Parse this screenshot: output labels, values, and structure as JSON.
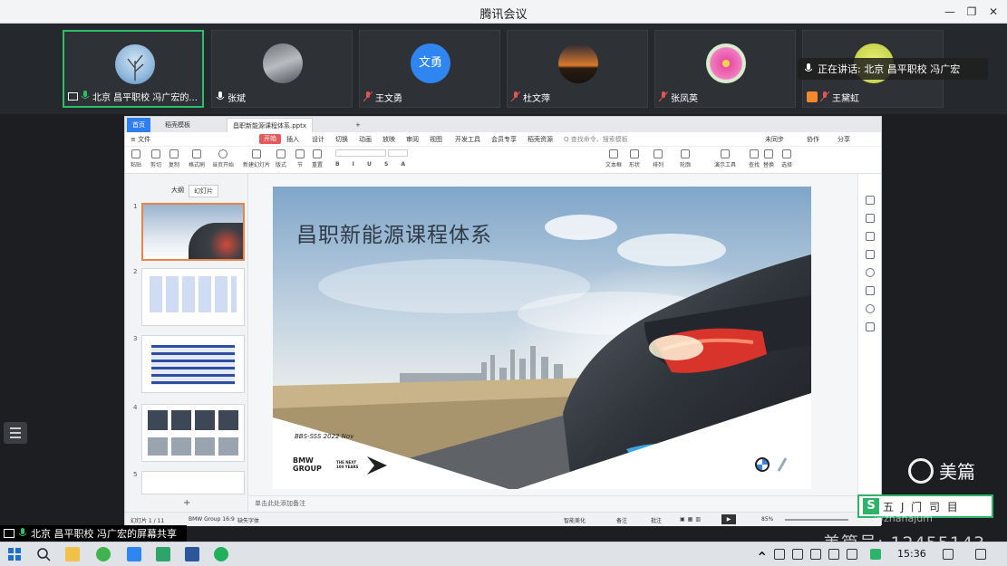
{
  "window": {
    "title": "腾讯会议"
  },
  "participants": [
    {
      "name": "北京 昌平职校 冯广宏的...",
      "avatar": "tree-photo-avatar"
    },
    {
      "name": "张斌",
      "avatar": "photo-avatar"
    },
    {
      "name": "王文勇",
      "avatar_text": "文勇",
      "avatar_color": "#2f86f0"
    },
    {
      "name": "杜文萍",
      "avatar": "sunset-avatar"
    },
    {
      "name": "张凤英",
      "avatar": "flower-avatar"
    },
    {
      "name": "王黛虹",
      "avatar": "yellow-avatar"
    }
  ],
  "speaking": {
    "label": "正在讲话: 北京 昌平职校 冯广宏"
  },
  "wps": {
    "tabs": {
      "home": "首页",
      "template": "稻壳模板",
      "file": "昌职新能源课程体系.pptx",
      "add": "+"
    },
    "menu": [
      "≡ 文件",
      "开始",
      "插入",
      "设计",
      "切换",
      "动画",
      "放映",
      "审阅",
      "视图",
      "开发工具",
      "会员专享",
      "稻壳资源",
      "Q 查找命令、搜索模板"
    ],
    "menu_right": [
      "未同步",
      "协作",
      "分享"
    ],
    "ribbon": [
      "粘贴",
      "剪切",
      "复制",
      "格式刷",
      "当页开始",
      "新建幻灯片",
      "版式",
      "节",
      "重置",
      "文本框",
      "形状",
      "排列",
      "轮廓",
      "演示工具",
      "查找",
      "替换",
      "选择"
    ],
    "panel_tabs": [
      "大纲",
      "幻灯片"
    ],
    "thumb_numbers": [
      "1",
      "2",
      "3",
      "4",
      "5"
    ],
    "slide": {
      "title": "昌职新能源课程体系",
      "date": "BBS-SSS 2022 Nov",
      "brand": "BMW\nGROUP",
      "tagline": "THE NEXT\n100 YEARS"
    },
    "notes": "单击此处添加备注",
    "status": {
      "slide": "幻灯片 1 / 11",
      "theme": "BMW Group 16:9",
      "font": "缺失字体",
      "beautify": "智能美化",
      "notes": "备注",
      "comment": "批注",
      "zoom": "85%"
    }
  },
  "watermark": {
    "brand": "美篇",
    "stamp_text": "五 J 门 司 目",
    "id_text": "@zhanajum",
    "number": "美篇号: 12455143"
  },
  "share_banner": "北京 昌平职校 冯广宏的屏幕共享",
  "taskbar": {
    "time": "15:36"
  }
}
